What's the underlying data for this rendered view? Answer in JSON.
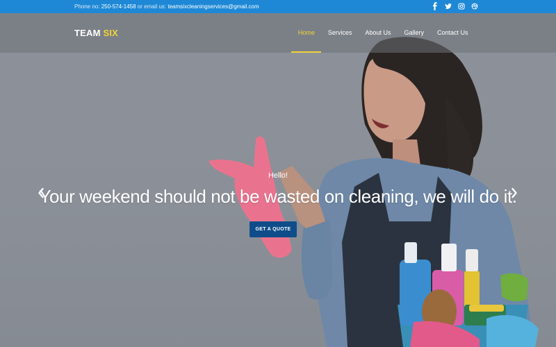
{
  "topbar": {
    "phone_label": "Phone no:",
    "phone": "250-574-1458",
    "email_label": "or email us:",
    "email": "teamsixcleaningservices@gmail.com",
    "social": [
      "facebook-icon",
      "twitter-icon",
      "instagram-icon",
      "dribbble-icon"
    ],
    "bg_color": "#1e88d6"
  },
  "brand": {
    "part1": "TEAM",
    "part2": "SIX",
    "accent_color": "#f2d335"
  },
  "nav": {
    "items": [
      {
        "label": "Home",
        "active": true
      },
      {
        "label": "Services",
        "active": false
      },
      {
        "label": "About Us",
        "active": false
      },
      {
        "label": "Gallery",
        "active": false
      },
      {
        "label": "Contact Us",
        "active": false
      }
    ]
  },
  "hero": {
    "greeting": "Hello!",
    "headline": "Your weekend should not be wasted on cleaning, we will do it.",
    "cta_label": "GET A QUOTE",
    "cta_color": "#0f4d8a",
    "prev_icon": "chevron-left-icon",
    "next_icon": "chevron-right-icon"
  }
}
